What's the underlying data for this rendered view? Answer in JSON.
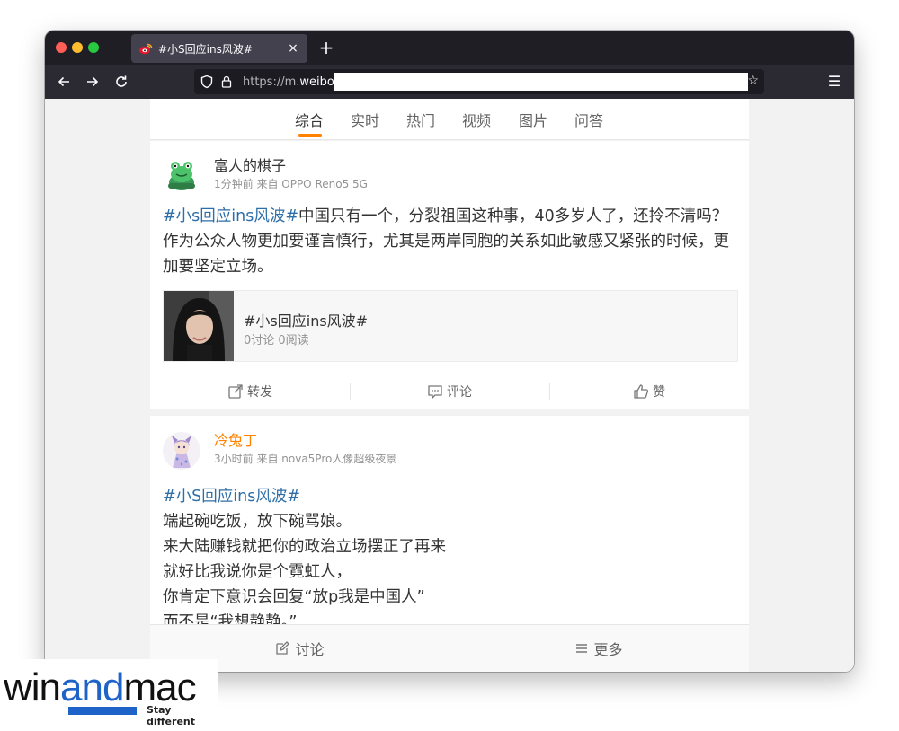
{
  "browser": {
    "tab_title": "#小S回应ins风波#",
    "tab_close": "×",
    "new_tab": "+",
    "url_prefix": "https://m.",
    "url_domain": "weibo.cn",
    "icons": [
      "back-arrow-icon",
      "forward-arrow-icon",
      "reload-icon",
      "shield-icon",
      "lock-icon",
      "bookmark-star-icon",
      "hamburger-menu-icon",
      "weibo-favicon"
    ]
  },
  "filter_tabs": [
    {
      "label": "综合",
      "active": true
    },
    {
      "label": "实时",
      "active": false
    },
    {
      "label": "热门",
      "active": false
    },
    {
      "label": "视频",
      "active": false
    },
    {
      "label": "图片",
      "active": false
    },
    {
      "label": "问答",
      "active": false
    }
  ],
  "posts": [
    {
      "username": "富人的棋子",
      "meta": "1分钟前 来自 OPPO Reno5 5G",
      "hashtag": "#小s回应ins风波#",
      "text": "中国只有一个，分裂祖国这种事，40多岁人了，还拎不清吗？作为公众人物更加要谨言慎行，尤其是两岸同胞的关系如此敏感又紧张的时候，更加要坚定立场。",
      "attachment": {
        "title": "#小s回应ins风波#",
        "meta": "0讨论 0阅读"
      },
      "actions": {
        "repost": "转发",
        "comment": "评论",
        "like": "赞"
      }
    },
    {
      "username": "冷兔丁",
      "meta": "3小时前 来自 nova5Pro人像超级夜景",
      "hashtag": "#小S回应ins风波#",
      "lines": [
        "端起碗吃饭，放下碗骂娘。",
        "来大陆赚钱就把你的政治立场摆正了再来",
        "就好比我说你是个霓虹人，",
        "你肯定下意识会回复“放p我是中国人”",
        "而不是“我想静静。”"
      ]
    }
  ],
  "bottom_bar": {
    "discuss": "讨论",
    "more": "更多"
  },
  "watermark": {
    "win": "win",
    "and": "and",
    "mac": "mac",
    "tagline": "Stay different"
  },
  "colors": {
    "accent_orange": "#ff8200",
    "hashtag_blue": "#2e6ea8",
    "logo_blue": "#1e64c8",
    "browser_dark": "#1f1e25"
  }
}
